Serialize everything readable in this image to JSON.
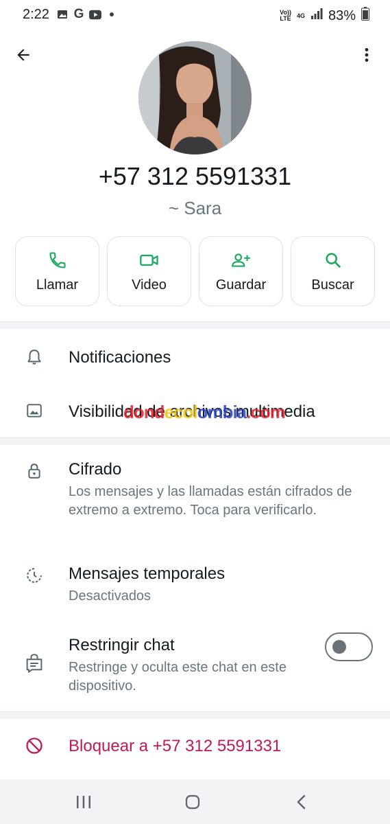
{
  "status_bar": {
    "time": "2:22",
    "left_icons": [
      "image-icon",
      "google-icon",
      "youtube-icon",
      "dot-icon"
    ],
    "volte_label": "VoLTE",
    "network_label": "4G",
    "battery": "83%"
  },
  "header": {
    "back_icon": "arrow-back-icon",
    "menu_icon": "more-vert-icon"
  },
  "contact": {
    "phone": "+57 312 5591331",
    "alias": "~ Sara"
  },
  "actions": [
    {
      "label": "Llamar",
      "icon": "phone-icon"
    },
    {
      "label": "Video",
      "icon": "video-icon"
    },
    {
      "label": "Guardar",
      "icon": "add-contact-icon"
    },
    {
      "label": "Buscar",
      "icon": "search-icon"
    }
  ],
  "settings": {
    "notifications": "Notificaciones",
    "media_visibility": "Visibilidad de archivos multimedia",
    "encryption_title": "Cifrado",
    "encryption_sub": "Los mensajes y las llamadas están cifrados de extremo a extremo. Toca para verificarlo.",
    "temp_title": "Mensajes temporales",
    "temp_sub": "Desactivados",
    "restrict_title": "Restringir chat",
    "restrict_sub": "Restringe y oculta este chat en este dispositivo.",
    "restrict_enabled": false,
    "block": "Bloquear a +57 312 5591331"
  },
  "watermark": {
    "p1": "dond",
    "p2": "ecol",
    "p3": "ombia",
    "p4": ".com"
  },
  "colors": {
    "accent": "#1daa61",
    "danger": "#c2185b",
    "text": "#111b21",
    "secondary": "#667781"
  }
}
